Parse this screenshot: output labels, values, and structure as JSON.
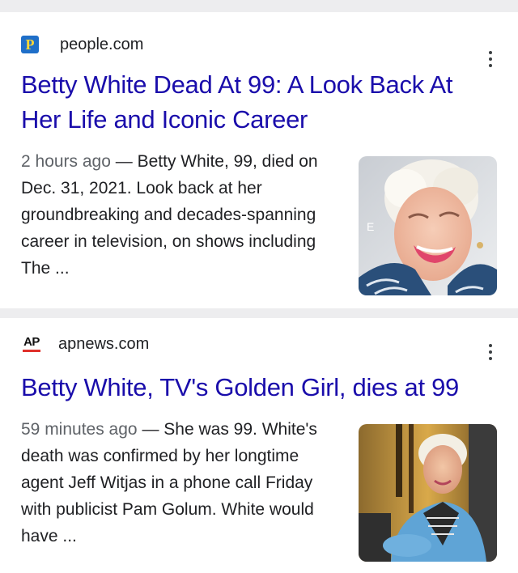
{
  "results": [
    {
      "source": "people.com",
      "favicon_letter": "P",
      "title": "Betty White Dead At 99: A Look Back At Her Life and Iconic Career",
      "age": "2 hours ago",
      "dash": " — ",
      "snippet": "Betty White, 99, died on Dec. 31, 2021. Look back at her groundbreaking and decades-spanning career in television, on shows including The ...",
      "thumb_letter": "E"
    },
    {
      "source": "apnews.com",
      "favicon_letter": "AP",
      "title": "Betty White, TV's Golden Girl, dies at 99",
      "age": "59 minutes ago",
      "dash": " — ",
      "snippet": "She was 99. White's death was confirmed by her longtime agent Jeff Witjas in a phone call Friday with publicist Pam Golum. White would have ..."
    }
  ],
  "colors": {
    "link": "#1a0dab",
    "text": "#202124",
    "meta": "#5f6368",
    "people_blue": "#1f6fc9",
    "people_yellow": "#ffd836",
    "ap_red": "#e0312b"
  }
}
